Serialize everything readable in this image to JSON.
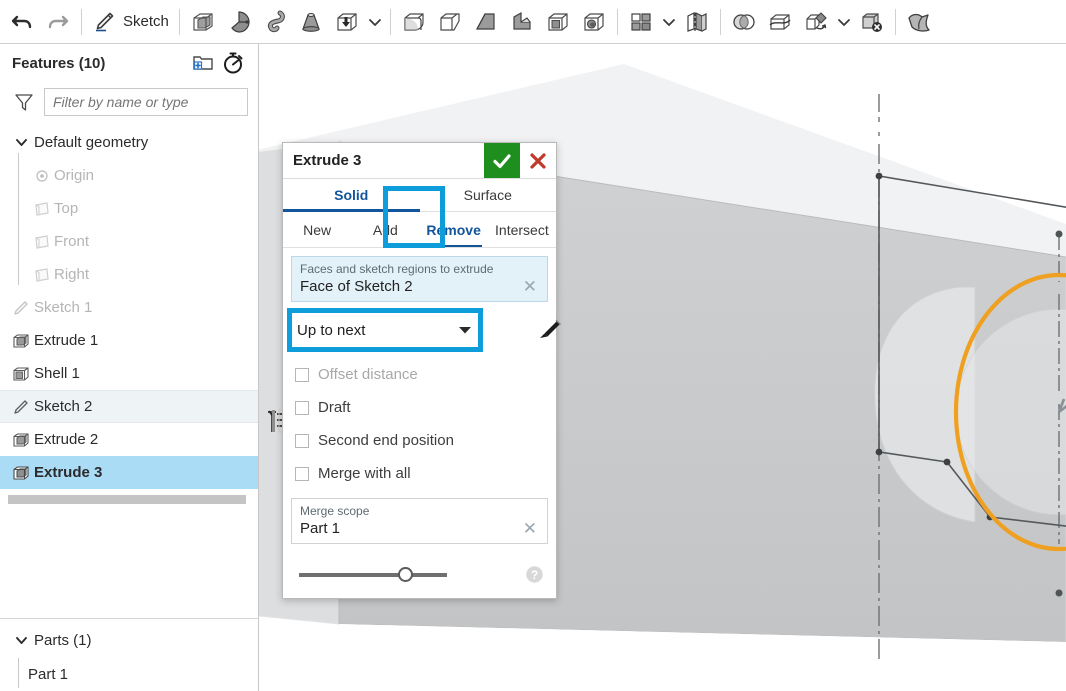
{
  "toolbar": {
    "undo_label": "Undo",
    "redo_label": "Redo",
    "sketch_label": "Sketch",
    "items": [
      {
        "name": "undo-button",
        "icon": "undo-icon"
      },
      {
        "name": "redo-button",
        "icon": "redo-icon"
      },
      {
        "name": "sketch-button",
        "icon": "sketch-pencil-icon",
        "label": "Sketch"
      },
      {
        "name": "extrude-button",
        "icon": "extrude-icon"
      },
      {
        "name": "revolve-button",
        "icon": "revolve-icon"
      },
      {
        "name": "sweep-button",
        "icon": "sweep-icon"
      },
      {
        "name": "loft-button",
        "icon": "loft-icon"
      },
      {
        "name": "thicken-button",
        "icon": "thicken-icon"
      },
      {
        "name": "more-solid-features-caret",
        "icon": "chevron-down-icon"
      },
      {
        "name": "fillet-button",
        "icon": "fillet-icon"
      },
      {
        "name": "chamfer-button",
        "icon": "chamfer-icon"
      },
      {
        "name": "draft-button",
        "icon": "draft-icon"
      },
      {
        "name": "rib-button",
        "icon": "rib-icon"
      },
      {
        "name": "shell-button",
        "icon": "shell-icon"
      },
      {
        "name": "hole-button",
        "icon": "hole-icon"
      },
      {
        "name": "pattern-button",
        "icon": "pattern-icon"
      },
      {
        "name": "pattern-caret",
        "icon": "chevron-down-icon"
      },
      {
        "name": "mirror-button",
        "icon": "mirror-icon"
      },
      {
        "name": "boolean-button",
        "icon": "boolean-icon"
      },
      {
        "name": "split-button",
        "icon": "split-icon"
      },
      {
        "name": "transform-button",
        "icon": "transform-icon"
      },
      {
        "name": "transform-caret",
        "icon": "chevron-down-icon"
      },
      {
        "name": "delete-part-button",
        "icon": "delete-part-icon"
      },
      {
        "name": "plane-button",
        "icon": "plane-icon"
      }
    ]
  },
  "sidebar": {
    "title": "Features (10)",
    "new_folder_icon": "new-folder-icon",
    "rollback_icon": "rollback-stopwatch-icon",
    "filter": {
      "placeholder": "Filter by name or type",
      "value": "",
      "icon": "filter-funnel-icon"
    },
    "features": [
      {
        "label": "Default geometry",
        "icon": "chevron-down-icon",
        "type": "group",
        "state": "normal"
      },
      {
        "label": "Origin",
        "icon": "origin-icon",
        "type": "child",
        "state": "dim"
      },
      {
        "label": "Top",
        "icon": "plane-icon",
        "type": "child",
        "state": "dim"
      },
      {
        "label": "Front",
        "icon": "plane-icon",
        "type": "child",
        "state": "dim"
      },
      {
        "label": "Right",
        "icon": "plane-icon",
        "type": "child",
        "state": "dim"
      },
      {
        "label": "Sketch 1",
        "icon": "sketch-icon",
        "type": "feature",
        "state": "dim"
      },
      {
        "label": "Extrude 1",
        "icon": "extrude-icon",
        "type": "feature",
        "state": "normal"
      },
      {
        "label": "Shell 1",
        "icon": "shell-icon",
        "type": "feature",
        "state": "normal"
      },
      {
        "label": "Sketch 2",
        "icon": "sketch-icon",
        "type": "feature",
        "state": "hover"
      },
      {
        "label": "Extrude 2",
        "icon": "extrude-icon",
        "type": "feature",
        "state": "normal"
      },
      {
        "label": "Extrude 3",
        "icon": "extrude-icon",
        "type": "feature",
        "state": "selected"
      }
    ],
    "rollback_bar": "rollback-bar",
    "parts": {
      "title": "Parts (1)",
      "icon": "chevron-down-icon",
      "items": [
        {
          "label": "Part 1"
        }
      ]
    }
  },
  "dialog": {
    "title": "Extrude 3",
    "accept_icon": "checkmark-icon",
    "cancel_icon": "close-x-icon",
    "primary_tabs": [
      {
        "label": "Solid",
        "active": true
      },
      {
        "label": "Surface",
        "active": false
      }
    ],
    "operation_tabs": [
      {
        "label": "New",
        "active": false
      },
      {
        "label": "Add",
        "active": false
      },
      {
        "label": "Remove",
        "active": true,
        "highlighted": true
      },
      {
        "label": "Intersect",
        "active": false
      }
    ],
    "faces_field": {
      "label": "Faces and sketch regions to extrude",
      "value": "Face of Sketch 2",
      "clear_icon": "clear-x-icon"
    },
    "end_condition": {
      "value": "Up to next",
      "caret_icon": "chevron-down-icon",
      "direction_icon": "flip-direction-arrow-icon",
      "highlighted": true
    },
    "checkboxes": [
      {
        "label": "Offset distance",
        "checked": false,
        "disabled": true
      },
      {
        "label": "Draft",
        "checked": false,
        "disabled": false
      },
      {
        "label": "Second end position",
        "checked": false,
        "disabled": false
      },
      {
        "label": "Merge with all",
        "checked": false,
        "disabled": false
      }
    ],
    "merge_scope": {
      "label": "Merge scope",
      "value": "Part 1",
      "clear_icon": "clear-x-icon"
    },
    "opacity_slider": {
      "value": 67
    },
    "help_icon": "help-question-icon"
  },
  "viewport": {
    "selected_edge_color": "#f0a020",
    "face_color": "#c8cacc",
    "edge_color": "#55595c",
    "direction_handle_icon": "extrude-direction-arrow-icon"
  },
  "colors": {
    "accent_highlight": "#0d9ddb",
    "tab_active": "#12559b",
    "selection_blue": "#aadcf5",
    "accept_green": "#1e8e1e",
    "cancel_red": "#c0392b",
    "orange_edge": "#f0a020"
  }
}
